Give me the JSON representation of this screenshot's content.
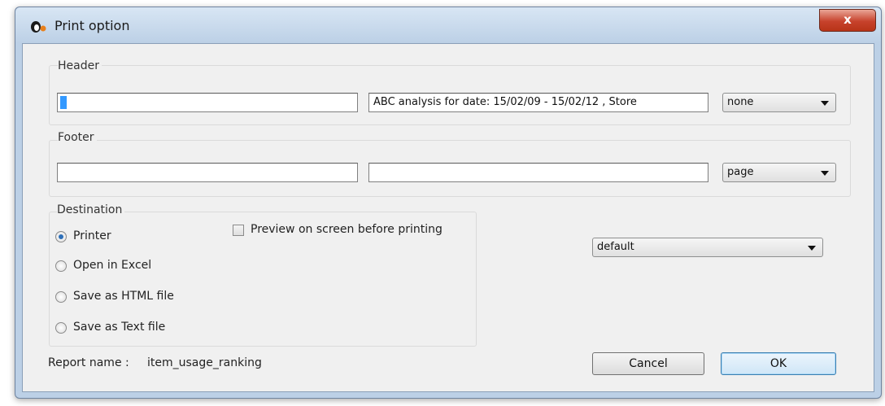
{
  "window": {
    "title": "Print option",
    "close_label": "x",
    "app_icon": "penguin-icon"
  },
  "header": {
    "group_title": "Header",
    "left_value": "",
    "center_value": "ABC analysis for date: 15/02/09 - 15/02/12 ,   Store",
    "select_value": "none"
  },
  "footer": {
    "group_title": "Footer",
    "left_value": "",
    "center_value": "",
    "select_value": "page"
  },
  "destination": {
    "group_title": "Destination",
    "options": [
      {
        "label": "Printer",
        "checked": true
      },
      {
        "label": "Open in Excel",
        "checked": false
      },
      {
        "label": "Save as HTML file",
        "checked": false
      },
      {
        "label": "Save as Text file",
        "checked": false
      }
    ],
    "preview_label": "Preview on screen before printing",
    "preview_checked": false
  },
  "printer_select": {
    "value": "default"
  },
  "report": {
    "label": "Report name :",
    "value": "item_usage_ranking"
  },
  "buttons": {
    "cancel": "Cancel",
    "ok": "OK"
  },
  "colors": {
    "accent": "#3399ff",
    "close": "#c7422c",
    "frame": "#bcd0e6"
  }
}
